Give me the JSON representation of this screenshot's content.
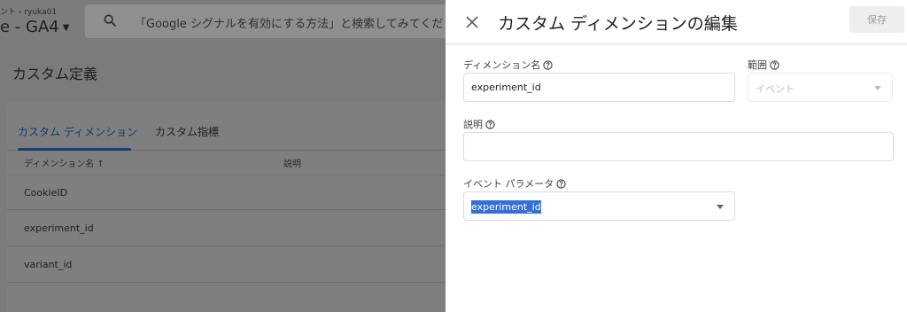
{
  "header": {
    "account_crumb": "ント › ryuka01",
    "property_name": "e - GA4",
    "search_placeholder": "「Google シグナルを有効にする方法」と検索してみてくだ"
  },
  "page": {
    "title": "カスタム定義",
    "tabs": [
      {
        "label": "カスタム ディメンション",
        "active": true
      },
      {
        "label": "カスタム指標",
        "active": false
      }
    ],
    "columns": [
      {
        "label": "ディメンション名 ↑"
      },
      {
        "label": "説明"
      }
    ],
    "rows": [
      {
        "name": "CookieID"
      },
      {
        "name": "experiment_id"
      },
      {
        "name": "variant_id"
      }
    ]
  },
  "panel": {
    "title": "カスタム ディメンションの編集",
    "save_label": "保存",
    "fields": {
      "dimension_name": {
        "label": "ディメンション名",
        "value": "experiment_id"
      },
      "scope": {
        "label": "範囲",
        "value": "イベント"
      },
      "description": {
        "label": "説明",
        "value": ""
      },
      "event_parameter": {
        "label": "イベント パラメータ",
        "value": "experiment_id"
      }
    }
  },
  "icons": {
    "close": "close-icon",
    "search": "search-icon",
    "help": "help-circle-icon",
    "dropdown": "chevron-down-icon"
  },
  "colors": {
    "accent": "#3470d8",
    "overlay": "#7b7b7b",
    "tab_active": "#103a6d"
  }
}
